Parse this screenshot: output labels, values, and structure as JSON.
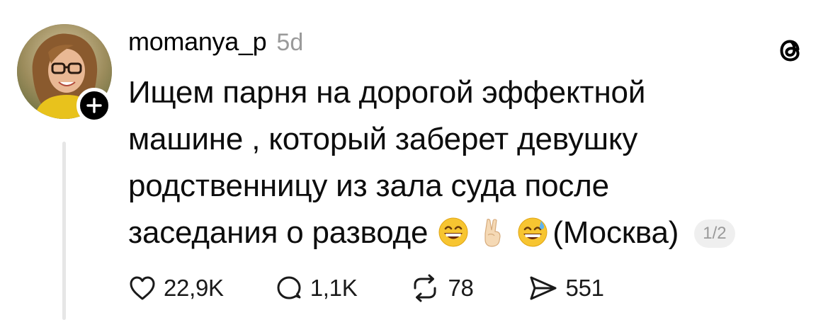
{
  "post": {
    "author": {
      "username": "momanya_p",
      "timestamp": "5d"
    },
    "text_lines": [
      "Ищем парня на дорогой эффектной",
      "машине , который заберет девушку",
      "родственницу из зала суда после",
      "заседания о разводе"
    ],
    "text_suffix": "(Москва)",
    "emojis": [
      "grinning-face-with-smiling-eyes",
      "victory-hand",
      "grinning-face-with-sweat"
    ],
    "page_indicator": "1/2",
    "stats": {
      "likes": "22,9K",
      "replies": "1,1K",
      "reposts": "78",
      "shares": "551"
    }
  },
  "icons": {
    "follow": "plus-icon",
    "brand": "threads-logo-icon",
    "like": "heart-icon",
    "reply": "comment-icon",
    "repost": "repost-icon",
    "share": "send-icon"
  },
  "colors": {
    "text": "#000000",
    "muted": "#9a9a9a",
    "thread_line": "#e6e6e6",
    "badge": "#000000"
  }
}
